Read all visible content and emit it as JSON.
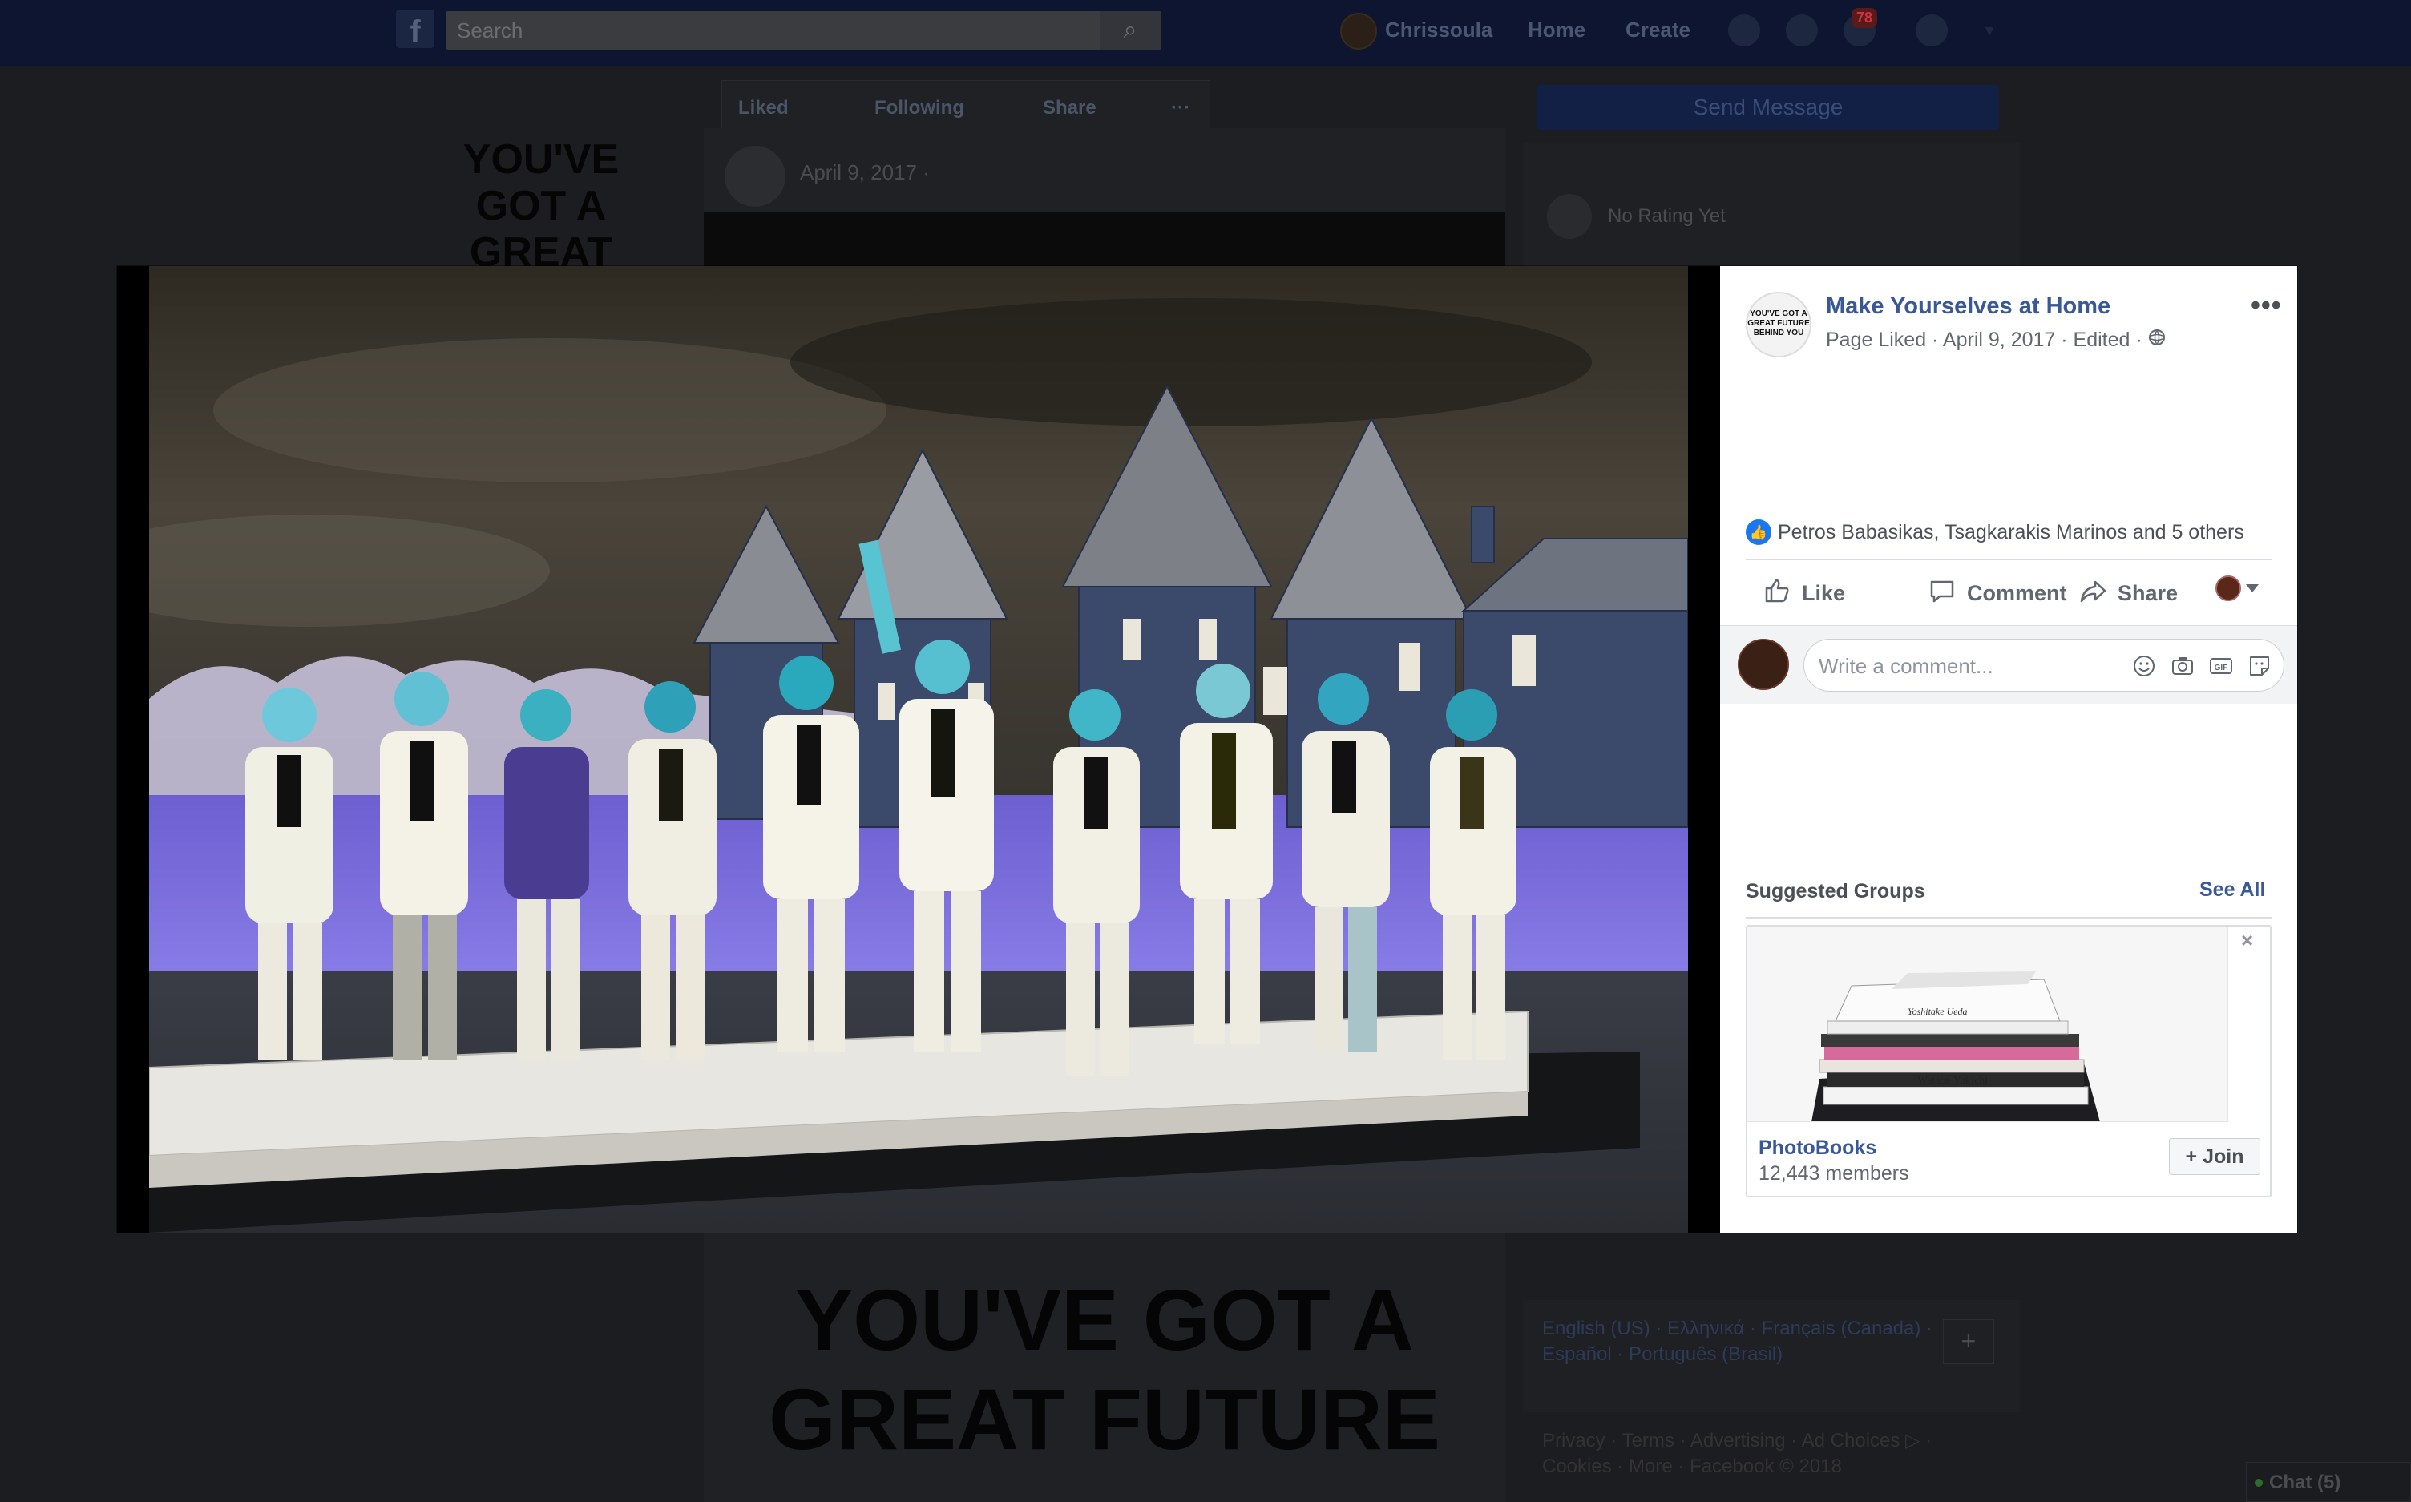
{
  "topbar": {
    "search_placeholder": "Search",
    "user_name": "Chrissoula",
    "home": "Home",
    "create": "Create",
    "notif_count": "78"
  },
  "page_actions": {
    "liked": "Liked",
    "following": "Following",
    "share": "Share",
    "more": "···"
  },
  "sidebar": {
    "send_message": "Send Message",
    "rating": "No Rating Yet",
    "languages": "English (US) · Ελληνικά · Français (Canada) · Español · Português (Brasil)",
    "lang_plus": "+",
    "footer_links": "Privacy · Terms · Advertising · Ad Choices ▷ · Cookies · More · Facebook © 2018",
    "chat": "Chat (5)"
  },
  "background_post": {
    "left_logo": "YOU'VE GOT A GREAT FUTURE",
    "date": "April 9, 2017 · ",
    "big_title": "YOU'VE GOT A GREAT FUTURE"
  },
  "panel": {
    "avatar_text": "YOU'VE GOT A GREAT FUTURE BEHIND YOU",
    "page_name": "Make Yourselves at Home",
    "meta": "Page Liked · April 9, 2017 · Edited · ",
    "more": "•••",
    "reactions_text": "Petros Babasikas, Tsagkarakis Marinos and 5 others",
    "actions": {
      "like": "Like",
      "comment": "Comment",
      "share": "Share"
    },
    "comment_placeholder": "Write a comment...",
    "suggested": {
      "title": "Suggested Groups",
      "see_all": "See All",
      "close": "×",
      "group_name": "PhotoBooks",
      "members": "12,443 members",
      "join": "+ Join"
    }
  },
  "colors": {
    "link_blue": "#385898",
    "like_blue": "#1877f2",
    "topbar": "#0d1530"
  }
}
